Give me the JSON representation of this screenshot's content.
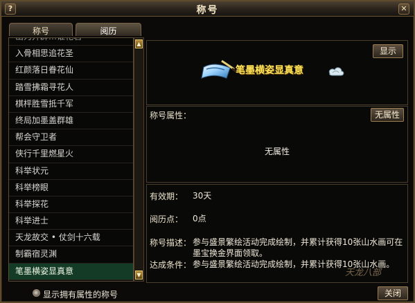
{
  "window": {
    "title": "称号",
    "help": "?",
    "close": "✕"
  },
  "tabs": [
    {
      "label": "称号",
      "active": false
    },
    {
      "label": "阅历",
      "active": true
    }
  ],
  "titles_list": {
    "items": [
      {
        "label": "山为开辟…谁花君",
        "partial": true
      },
      {
        "label": "入骨相思追花圣"
      },
      {
        "label": "红颜落日眷花仙"
      },
      {
        "label": "踏雪拂霜寻花人"
      },
      {
        "label": "棋枰胜雪抵千军"
      },
      {
        "label": "终局加墨盖群雄"
      },
      {
        "label": "帮会守卫者"
      },
      {
        "label": "侠行千里燃星火"
      },
      {
        "label": "科举状元"
      },
      {
        "label": "科举榜眼"
      },
      {
        "label": "科举探花"
      },
      {
        "label": "科举进士"
      },
      {
        "label": "天龙故交 • 仗剑十六载"
      },
      {
        "label": "制霸宿灵渊"
      },
      {
        "label": "笔墨横姿显真意",
        "selected": true
      }
    ],
    "scroll_up": "▲",
    "scroll_down": "▼"
  },
  "featured": {
    "name": "笔墨横姿显真意",
    "show_button": "显示"
  },
  "attributes": {
    "label": "称号属性：",
    "button": "无属性",
    "value": "无属性"
  },
  "details": {
    "validity_label": "有效期：",
    "validity_value": "30天",
    "points_label": "阅历点：",
    "points_value": "0点",
    "description_label": "称号描述：",
    "description_value": "参与盛景繁绘活动完成绘制，并累计获得10张山水画可在墨宝换金界面领取。",
    "condition_label": "达成条件：",
    "condition_value": "参与盛景繁绘活动完成绘制，并累计获得10张山水画。",
    "watermark": "天龙八部"
  },
  "bottom": {
    "filter_label": "显示拥有属性的称号",
    "close_button": "关闭"
  },
  "colors": {
    "selected_row": "#143b25",
    "title_highlight": "#ffe45a",
    "border": "#5e4a2c"
  }
}
